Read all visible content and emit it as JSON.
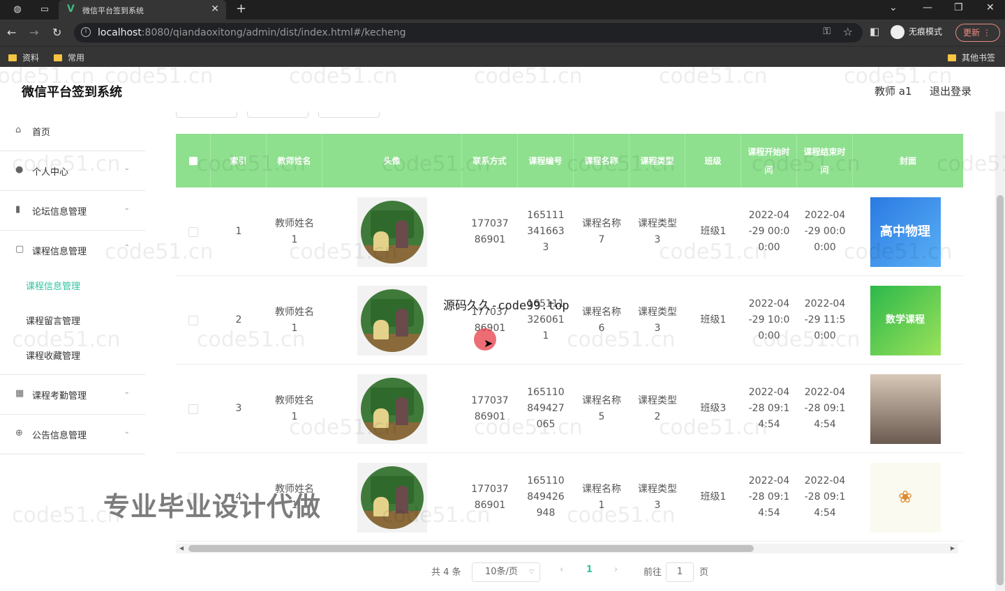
{
  "browser": {
    "tab_title": "微信平台签到系统",
    "url_host": "localhost",
    "url_rest": ":8080/qiandaoxitong/admin/dist/index.html#/kecheng",
    "incognito_label": "无痕模式",
    "update_label": "更新",
    "bookmarks": [
      "资料",
      "常用"
    ],
    "other_bookmarks": "其他书签"
  },
  "header": {
    "title": "微信平台签到系统",
    "user": "教师 a1",
    "logout": "退出登录"
  },
  "sidebar": {
    "items": [
      {
        "label": "首页",
        "icon": "home-icon"
      },
      {
        "label": "个人中心",
        "icon": "user-icon"
      },
      {
        "label": "论坛信息管理",
        "icon": "chart-icon"
      },
      {
        "label": "课程信息管理",
        "icon": "window-icon"
      },
      {
        "label": "课程考勤管理",
        "icon": "grid-icon"
      },
      {
        "label": "公告信息管理",
        "icon": "globe-icon"
      }
    ],
    "sub_items": [
      "课程信息管理",
      "课程留言管理",
      "课程收藏管理"
    ]
  },
  "table": {
    "columns": [
      "索引",
      "教师姓名",
      "头像",
      "联系方式",
      "课程编号",
      "课程名称",
      "课程类型",
      "班级",
      "课程开始时间",
      "课程结束时间",
      "封面"
    ],
    "rows": [
      {
        "index": "1",
        "teacher": "教师姓名1",
        "phone": "17703786901",
        "code": "1651113416633",
        "name": "课程名称7",
        "type": "课程类型3",
        "class": "班级1",
        "start": "2022-04-29 00:00:00",
        "end": "2022-04-29 00:00:00",
        "cover": "高中物理"
      },
      {
        "index": "2",
        "teacher": "教师姓名1",
        "phone": "17703786901",
        "code": "1651113260611",
        "name": "课程名称6",
        "type": "课程类型3",
        "class": "班级1",
        "start": "2022-04-29 10:00:00",
        "end": "2022-04-29 11:50:00",
        "cover": "数学课程"
      },
      {
        "index": "3",
        "teacher": "教师姓名1",
        "phone": "17703786901",
        "code": "165110849427065",
        "name": "课程名称5",
        "type": "课程类型2",
        "class": "班级3",
        "start": "2022-04-28 09:14:54",
        "end": "2022-04-28 09:14:54",
        "cover": ""
      },
      {
        "index": "4",
        "teacher": "教师姓名1",
        "phone": "17703786901",
        "code": "165110849426948",
        "name": "课程名称1",
        "type": "课程类型3",
        "class": "班级1",
        "start": "2022-04-28 09:14:54",
        "end": "2022-04-28 09:14:54",
        "cover": ""
      }
    ]
  },
  "pagination": {
    "total": "共 4 条",
    "page_size": "10条/页",
    "current": "1",
    "goto_label": "前往",
    "goto_value": "1",
    "page_suffix": "页"
  },
  "overlays": {
    "watermark": "code51.cn",
    "promo": "源码久久-code99.top",
    "banner": "专业毕业设计代做"
  }
}
